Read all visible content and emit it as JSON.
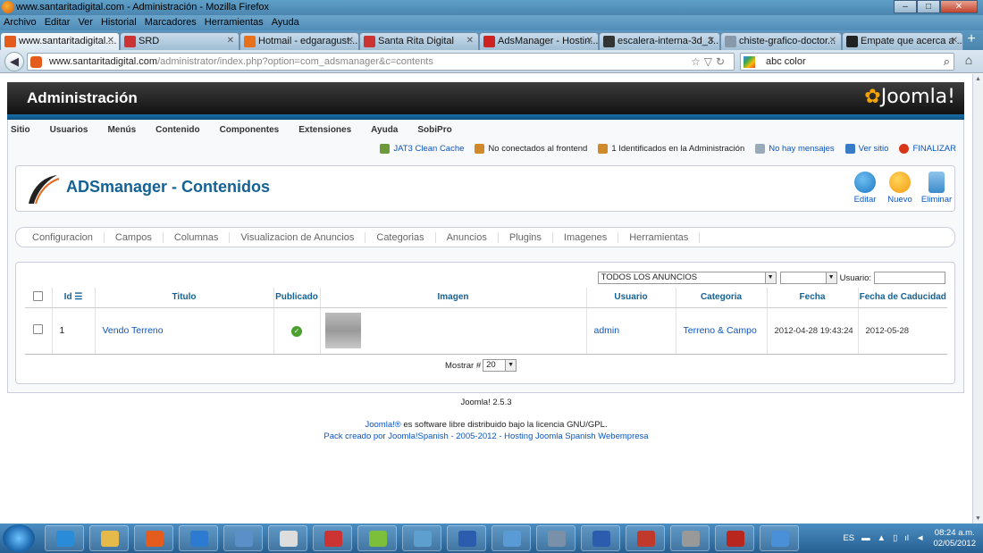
{
  "window": {
    "title": "www.santaritadigital.com - Administración - Mozilla Firefox",
    "controls": [
      "minimize-icon",
      "maximize-icon",
      "close-icon"
    ]
  },
  "menubar": [
    "Archivo",
    "Editar",
    "Ver",
    "Historial",
    "Marcadores",
    "Herramientas",
    "Ayuda"
  ],
  "tabs": [
    {
      "label": "www.santaritadigital....",
      "color": "#e35c1d"
    },
    {
      "label": "SRD",
      "color": "#c33"
    },
    {
      "label": "Hotmail - edgaragust...",
      "color": "#e8701a"
    },
    {
      "label": "Santa Rita Digital",
      "color": "#c33"
    },
    {
      "label": "AdsManager - Hostin...",
      "color": "#cc2222"
    },
    {
      "label": "escalera-interna-3d_3...",
      "color": "#333"
    },
    {
      "label": "chiste-grafico-doctor...",
      "color": "#8899aa"
    },
    {
      "label": "Empate que acerca a ...",
      "color": "#222"
    }
  ],
  "navbar": {
    "url_domain": "www.santaritadigital.com",
    "url_path": "/administrator/index.php?option=com_adsmanager&c=contents",
    "search_query": "abc color"
  },
  "admin": {
    "header_title": "Administración",
    "logo_text": "Joomla!"
  },
  "mainmenu": [
    "Sitio",
    "Usuarios",
    "Menús",
    "Contenido",
    "Componentes",
    "Extensiones",
    "Ayuda",
    "SobiPro"
  ],
  "status": {
    "cache": "JAT3 Clean Cache",
    "frontend": "No conectados al frontend",
    "admins": "1 Identificados en la Administración",
    "messages": "No hay mensajes",
    "view_site": "Ver sitio",
    "logout": "FINALIZAR"
  },
  "component": {
    "title": "ADSmanager - Contenidos",
    "buttons": {
      "edit": "Editar",
      "new": "Nuevo",
      "delete": "Eliminar"
    }
  },
  "submenu": [
    "Configuracion",
    "Campos",
    "Columnas",
    "Visualizacion de Anuncios",
    "Categorias",
    "Anuncios",
    "Plugins",
    "Imagenes",
    "Herramientas"
  ],
  "filters": {
    "ads_select": "TODOS LOS ANUNCIOS",
    "second_select": "",
    "user_label": "Usuario:",
    "user_value": ""
  },
  "table": {
    "headers": [
      "Id",
      "Titulo",
      "Publicado",
      "Imagen",
      "Usuario",
      "Categoria",
      "Fecha",
      "Fecha de Caducidad"
    ],
    "rows": [
      {
        "id": "1",
        "titulo": "Vendo Terreno",
        "usuario": "admin",
        "categoria": "Terreno & Campo",
        "fecha": "2012-04-28 19:43:24",
        "caducidad": "2012-05-28",
        "publicado": true
      }
    ]
  },
  "pager": {
    "label": "Mostrar #",
    "value": "20"
  },
  "footer": {
    "version": "Joomla! 2.5.3",
    "license_link": "Joomla!®",
    "license_text": " es software libre distribuido bajo la licencia GNU/GPL.",
    "pack": "Pack creado por Joomla!Spanish - 2005-2012 - Hosting Joomla Spanish Webempresa"
  },
  "taskbar": {
    "apps": [
      "ie-icon",
      "explorer-icon",
      "firefox-icon",
      "media-player-icon",
      "chart-app-icon",
      "clock-app-icon",
      "pin-app-icon",
      "android-icon",
      "network-icon",
      "word-icon",
      "paint-icon",
      "calculator-icon",
      "document-icon",
      "flag-icon",
      "camera-icon",
      "filezilla-icon",
      "cloud-icon"
    ],
    "lang": "ES",
    "time": "08:24 a.m.",
    "date": "02/05/2012"
  }
}
